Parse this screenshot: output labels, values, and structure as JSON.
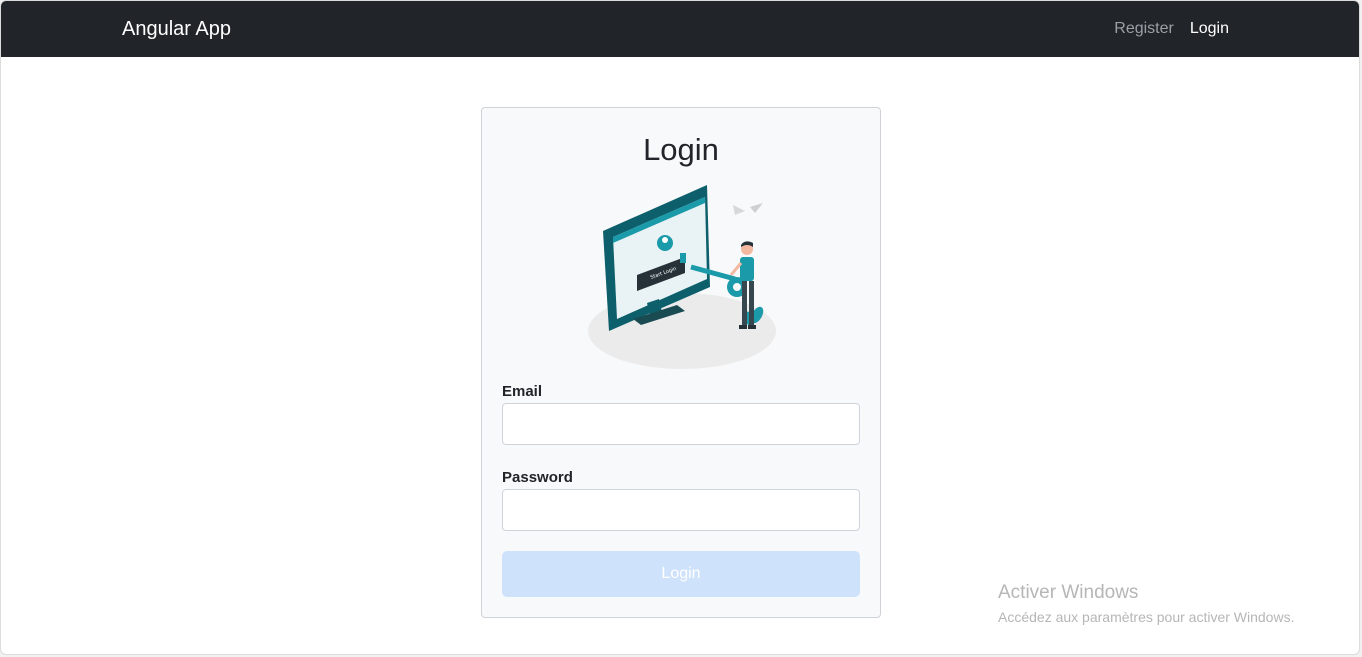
{
  "navbar": {
    "brand": "Angular App",
    "links": [
      {
        "label": "Register"
      },
      {
        "label": "Login"
      }
    ]
  },
  "login_card": {
    "title": "Login",
    "illustration_text": "Start Login",
    "email": {
      "label": "Email",
      "value": "",
      "placeholder": ""
    },
    "password": {
      "label": "Password",
      "value": "",
      "placeholder": ""
    },
    "submit_label": "Login",
    "colors": {
      "accent": "#1b9aaa",
      "button_disabled": "#cfe2fb"
    }
  },
  "watermark": {
    "title": "Activer Windows",
    "subtitle": "Accédez aux paramètres pour activer Windows."
  }
}
